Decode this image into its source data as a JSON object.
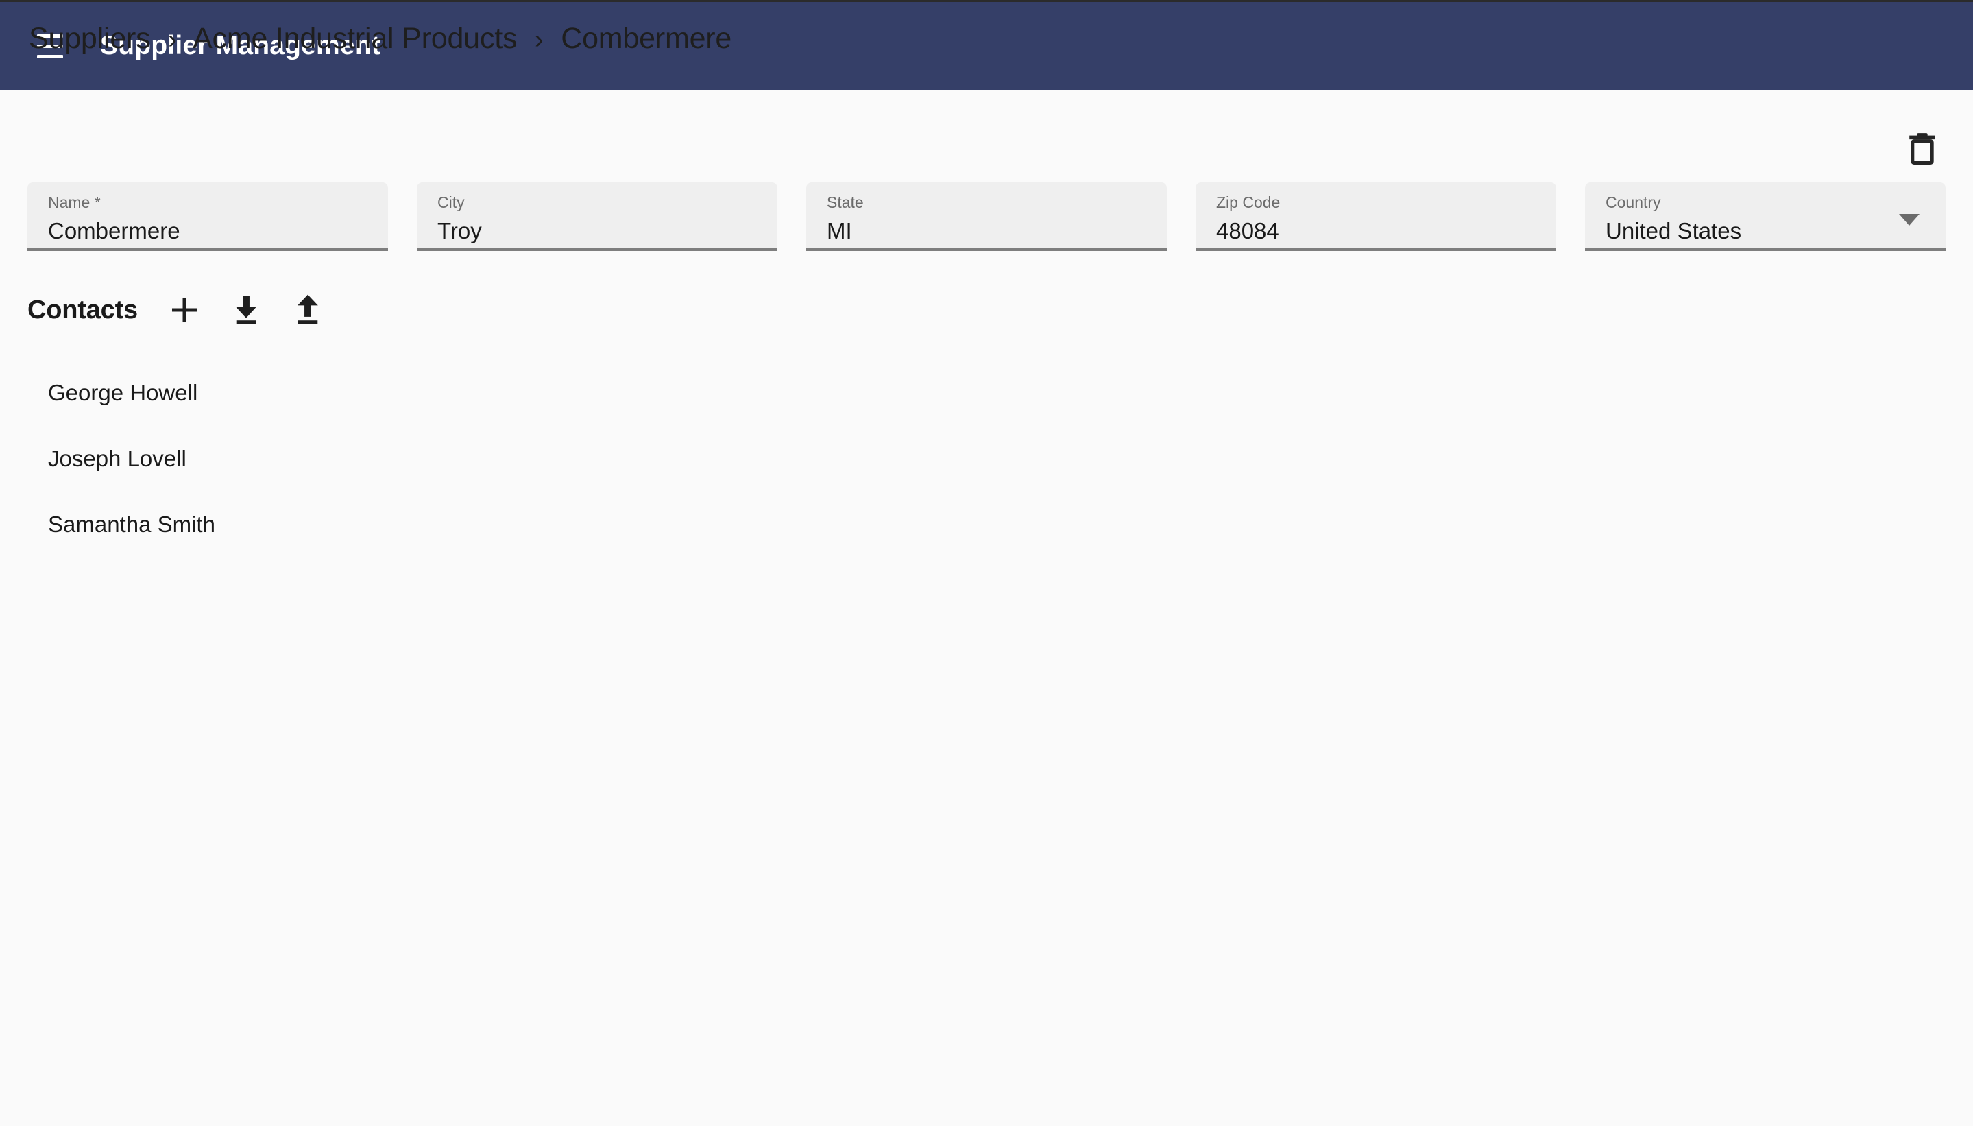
{
  "theme": {
    "appbar_bg": "#353f68",
    "page_bg": "#fafafa",
    "field_bg": "#efefef",
    "field_underline": "#7e7e7e",
    "text_primary": "#1a1a1a",
    "label_gray": "#6b6b6b"
  },
  "appbar": {
    "menu_icon": "hamburger-menu-icon",
    "title": "Supplier Management"
  },
  "breadcrumb": {
    "separator": "›",
    "items": [
      {
        "label": "Suppliers"
      },
      {
        "label": "Acme Industrial Products"
      },
      {
        "label": "Combermere"
      }
    ]
  },
  "actions": {
    "delete_icon": "trash-delete-icon",
    "delete_label": "Delete"
  },
  "form": {
    "fields": [
      {
        "label": "Name *",
        "value": "Combermere",
        "type": "text",
        "placeholder": "Name"
      },
      {
        "label": "City",
        "value": "Troy",
        "type": "text",
        "placeholder": "City"
      },
      {
        "label": "State",
        "value": "MI",
        "type": "text",
        "placeholder": "State"
      },
      {
        "label": "Zip Code",
        "value": "48084",
        "type": "text",
        "placeholder": "Zip Code"
      },
      {
        "label": "Country",
        "value": "United States",
        "type": "select",
        "placeholder": "Country"
      }
    ]
  },
  "contacts": {
    "title": "Contacts",
    "toolbar": [
      {
        "icon": "plus-add-icon",
        "label": "Add contact"
      },
      {
        "icon": "download-icon",
        "label": "Download contacts"
      },
      {
        "icon": "upload-icon",
        "label": "Upload contacts"
      }
    ],
    "items": [
      {
        "name": "George Howell"
      },
      {
        "name": "Joseph Lovell"
      },
      {
        "name": "Samantha Smith"
      }
    ]
  }
}
